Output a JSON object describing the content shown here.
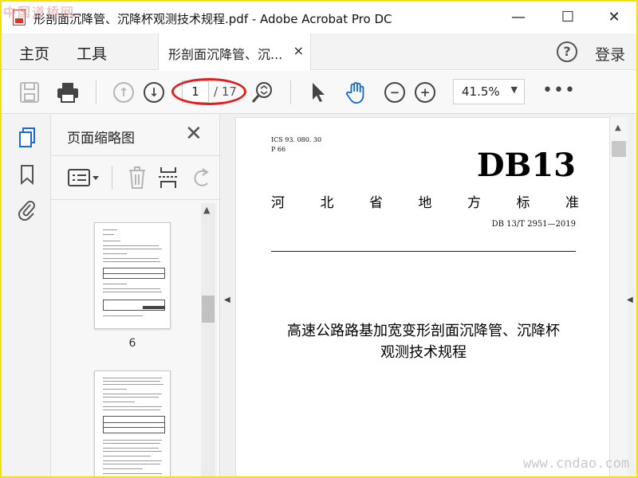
{
  "watermark": {
    "top": "中国道桥网",
    "bottom": "www.cndao.com"
  },
  "window": {
    "title": "形剖面沉降管、沉降杯观测技术规程.pdf - Adobe Acrobat Pro DC",
    "controls": {
      "minimize": "—",
      "maximize": "☐",
      "close": "✕"
    }
  },
  "menubar": {
    "home": "主页",
    "tools": "工具",
    "tab_label": "形剖面沉降管、沉...",
    "tab_close": "×",
    "help": "?",
    "login": "登录"
  },
  "toolbar": {
    "page_current": "1",
    "page_total": "/ 17",
    "zoom": "41.5%",
    "zoom_arrow": "▼",
    "more": "•••"
  },
  "thumbnails": {
    "title": "页面缩略图",
    "close": "✕",
    "pages": [
      {
        "number": "6"
      },
      {
        "number": ""
      }
    ]
  },
  "document": {
    "ics": "ICS  93. 080. 30",
    "p": "P  66",
    "code": "DB13",
    "issuer_chars": [
      "河",
      "北",
      "省",
      "地",
      "方",
      "标",
      "准"
    ],
    "standard_number": "DB 13/T  2951—2019",
    "title_line1": "高速公路路基加宽变形剖面沉降管、沉降杯",
    "title_line2": "观测技术规程"
  },
  "colors": {
    "annotation": "#e02020",
    "hand_tool": "#1a6ad1",
    "sidebar_icon": "#1a6ad1",
    "frame_border": "#f2e200"
  }
}
